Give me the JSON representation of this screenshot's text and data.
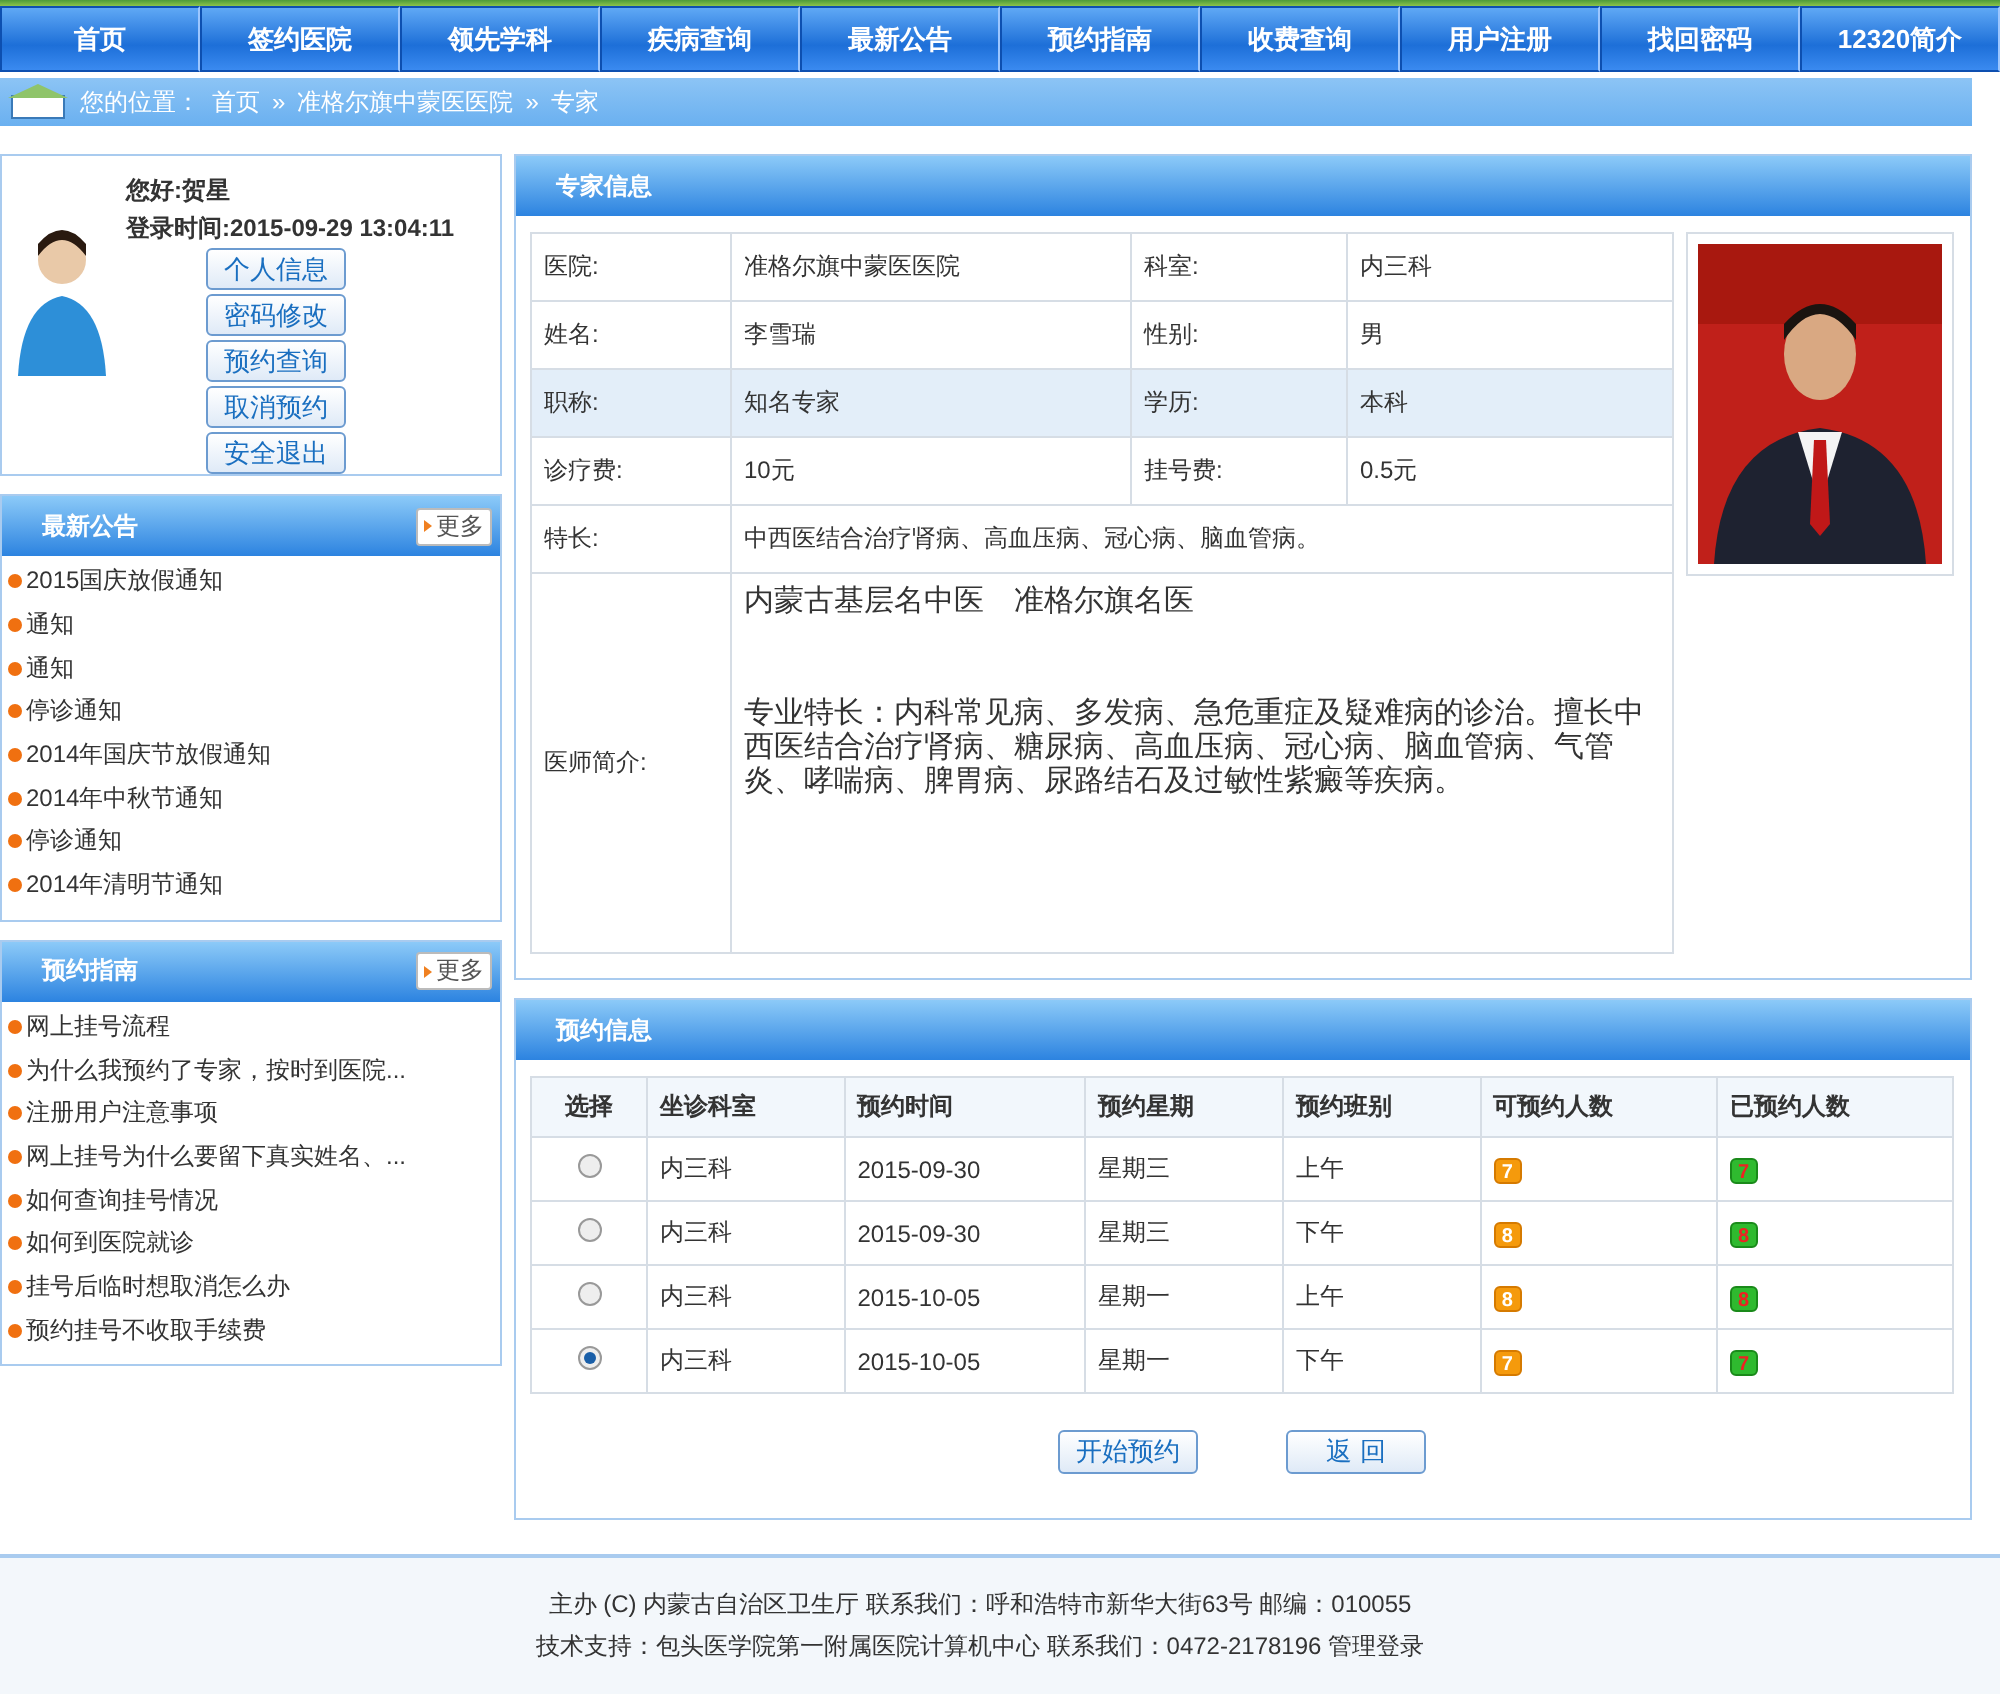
{
  "nav": [
    "首页",
    "签约医院",
    "领先学科",
    "疾病查询",
    "最新公告",
    "预约指南",
    "收费查询",
    "用户注册",
    "找回密码",
    "12320简介"
  ],
  "breadcrumb": {
    "label": "您的位置：",
    "separator": "»",
    "items": [
      "首页",
      "准格尔旗中蒙医医院",
      "专家"
    ]
  },
  "user": {
    "greeting": "您好:贺星",
    "login": "登录时间:2015-09-29 13:04:11",
    "buttons": [
      "个人信息",
      "密码修改",
      "预约查询",
      "取消预约",
      "安全退出"
    ]
  },
  "notices": {
    "title": "最新公告",
    "more": "更多",
    "items": [
      "2015国庆放假通知",
      "通知",
      "通知",
      "停诊通知",
      "2014年国庆节放假通知",
      "2014年中秋节通知",
      "停诊通知",
      "2014年清明节通知"
    ]
  },
  "guide": {
    "title": "预约指南",
    "more": "更多",
    "items": [
      "网上挂号流程",
      "为什么我预约了专家，按时到医院...",
      "注册用户注意事项",
      "网上挂号为什么要留下真实姓名、...",
      "如何查询挂号情况",
      "如何到医院就诊",
      "挂号后临时想取消怎么办",
      "预约挂号不收取手续费"
    ]
  },
  "expert": {
    "title": "专家信息",
    "rows": [
      {
        "cells": [
          "医院:",
          "准格尔旗中蒙医医院",
          "科室:",
          "内三科"
        ],
        "highlighted": false
      },
      {
        "cells": [
          "姓名:",
          "李雪瑞",
          "性别:",
          "男"
        ],
        "highlighted": false
      },
      {
        "cells": [
          "职称:",
          "知名专家",
          "学历:",
          "本科"
        ],
        "highlighted": true
      },
      {
        "cells": [
          "诊疗费:",
          "10元",
          "挂号费:",
          "0.5元"
        ],
        "highlighted": false
      }
    ],
    "specialty": {
      "label": "特长:",
      "value": "中西医结合治疗肾病、高血压病、冠心病、脑血管病。"
    },
    "intro": {
      "label": "医师简介:",
      "heading": "内蒙古基层名中医　准格尔旗名医",
      "body": "专业特长：内科常见病、多发病、急危重症及疑难病的诊治。擅长中西医结合治疗肾病、糖尿病、高血压病、冠心病、脑血管病、气管炎、哮喘病、脾胃病、尿路结石及过敏性紫癜等疾病。"
    }
  },
  "appointment": {
    "title": "预约信息",
    "columns": [
      "选择",
      "坐诊科室",
      "预约时间",
      "预约星期",
      "预约班别",
      "可预约人数",
      "已预约人数"
    ],
    "rows": [
      {
        "selected": false,
        "dept": "内三科",
        "date": "2015-09-30",
        "weekday": "星期三",
        "shift": "上午",
        "available": "7",
        "booked": "7"
      },
      {
        "selected": false,
        "dept": "内三科",
        "date": "2015-09-30",
        "weekday": "星期三",
        "shift": "下午",
        "available": "8",
        "booked": "8"
      },
      {
        "selected": false,
        "dept": "内三科",
        "date": "2015-10-05",
        "weekday": "星期一",
        "shift": "上午",
        "available": "8",
        "booked": "8"
      },
      {
        "selected": true,
        "dept": "内三科",
        "date": "2015-10-05",
        "weekday": "星期一",
        "shift": "下午",
        "available": "7",
        "booked": "7"
      }
    ],
    "buttons": [
      "开始预约",
      "返 回"
    ]
  },
  "footer": [
    "主办 (C) 内蒙古自治区卫生厅 联系我们：呼和浩特市新华大街63号 邮编：010055",
    "技术支持：包头医学院第一附属医院计算机中心 联系我们：0472-2178196 管理登录"
  ]
}
